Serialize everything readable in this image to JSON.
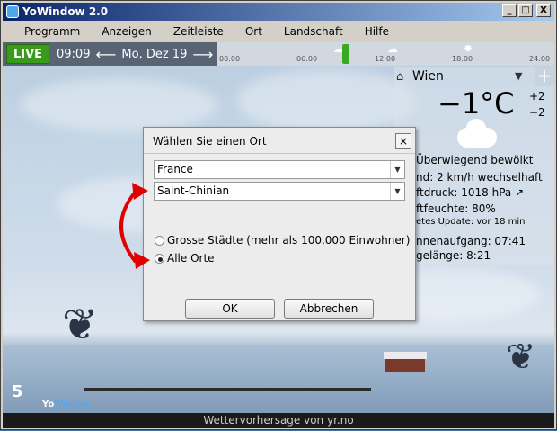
{
  "window": {
    "title": "YoWindow 2.0",
    "min": "_",
    "max": "□",
    "close": "X"
  },
  "menu": [
    "Programm",
    "Anzeigen",
    "Zeitleiste",
    "Ort",
    "Landschaft",
    "Hilfe"
  ],
  "toolbar": {
    "live": "LIVE",
    "time": "09:09",
    "date": "Mo, Dez 19",
    "back_arrow": "⟵",
    "fwd_arrow": "⟶"
  },
  "timeline": {
    "ticks": [
      "00:00",
      "06:00",
      "12:00",
      "18:00",
      "24:00"
    ]
  },
  "weather": {
    "city": "Wien",
    "temp": "−1°C",
    "plus": "+2",
    "minus": "−2",
    "condition": "Überwiegend bewölkt",
    "wind": "nd:  2 km/h wechselhaft",
    "pressure": "ftdruck:  1018 hPa ↗",
    "humidity": "ftfeuchte:  80%",
    "update": "etes Update:  vor 18 min",
    "sunrise": "nnenaufgang:  07:41",
    "daylength": "gelänge:  8:21",
    "add": "+"
  },
  "logo": {
    "num": "5",
    "yo": "Yo",
    "window": "Window"
  },
  "footer": "Wettervorhersage von yr.no",
  "dialog": {
    "title": "Wählen Sie einen Ort",
    "close": "×",
    "country": "France",
    "place": "Saint-Chinian",
    "radio_big": "Grosse Städte (mehr als 100,000 Einwohner)",
    "radio_all": "Alle Orte",
    "radio_selected": "Alle Orte",
    "ok": "OK",
    "cancel": "Abbrechen"
  },
  "colors": {
    "live": "#3a9a1c",
    "annotation": "#e00000",
    "titlebar": "#0a246a"
  }
}
